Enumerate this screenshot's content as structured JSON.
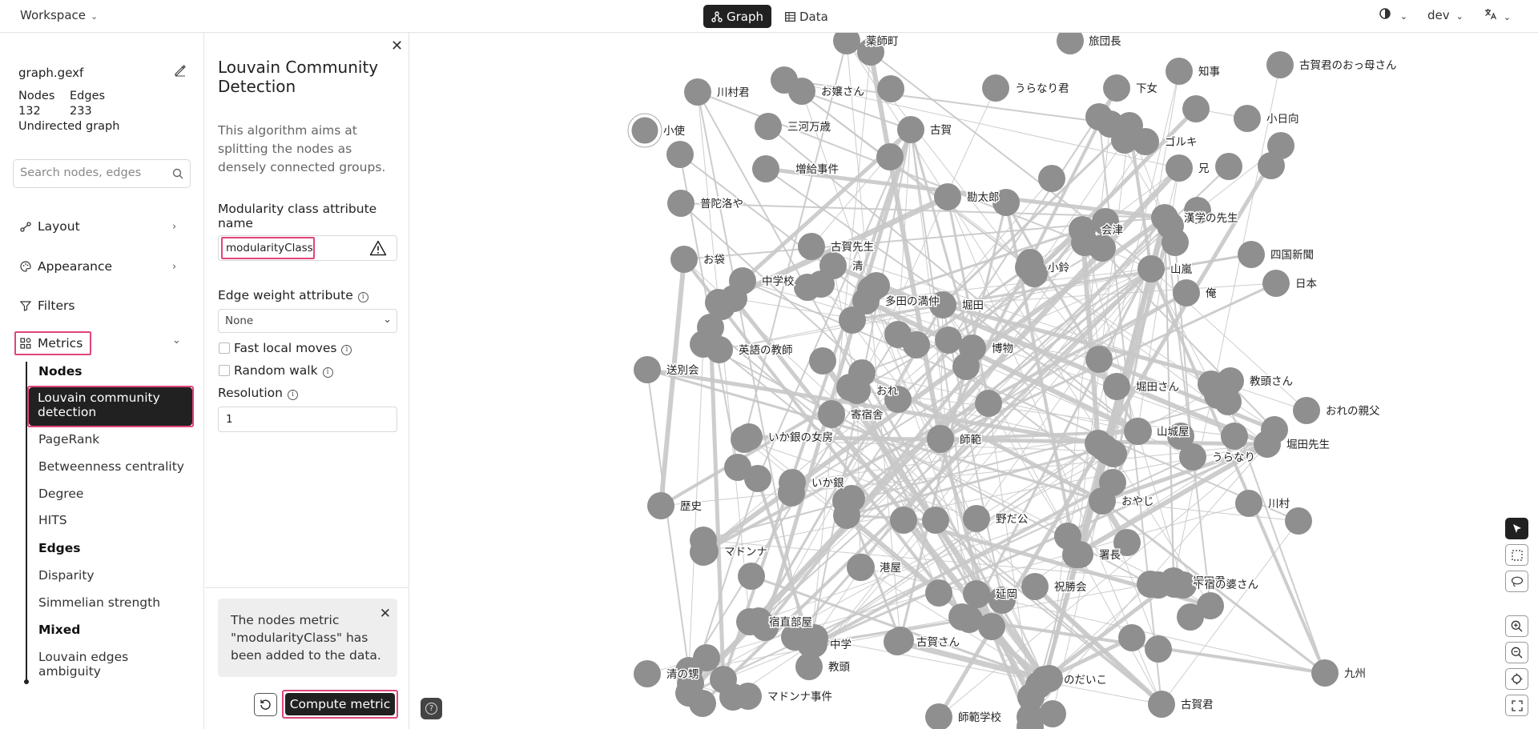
{
  "topbar": {
    "workspace_label": "Workspace",
    "tabs": [
      {
        "label": "Graph",
        "active": true
      },
      {
        "label": "Data",
        "active": false
      }
    ],
    "theme_icon": "contrast-icon",
    "user_label": "dev",
    "lang_icon": "translate-icon"
  },
  "sidebar": {
    "file_name": "graph.gexf",
    "nodes_label": "Nodes",
    "edges_label": "Edges",
    "nodes_count": "132",
    "edges_count": "233",
    "graph_type": "Undirected graph",
    "search_placeholder": "Search nodes, edges",
    "sections": [
      {
        "label": "Layout",
        "icon": "layout-icon"
      },
      {
        "label": "Appearance",
        "icon": "palette-icon"
      },
      {
        "label": "Filters",
        "icon": "filter-icon"
      },
      {
        "label": "Metrics",
        "icon": "metrics-icon"
      }
    ],
    "metrics_items": [
      {
        "label": "Nodes",
        "header": true
      },
      {
        "label": "Louvain community detection",
        "active": true
      },
      {
        "label": "PageRank"
      },
      {
        "label": "Betweenness centrality"
      },
      {
        "label": "Degree"
      },
      {
        "label": "HITS"
      },
      {
        "label": "Edges",
        "header": true
      },
      {
        "label": "Disparity"
      },
      {
        "label": "Simmelian strength"
      },
      {
        "label": "Mixed",
        "header": true
      },
      {
        "label": "Louvain edges ambiguity"
      }
    ]
  },
  "metric_panel": {
    "title": "Louvain Community Detection",
    "description": "This algorithm aims at splitting the nodes as densely connected groups.",
    "attr_label": "Modularity class attribute name",
    "attr_value": "modularityClass",
    "edge_weight_label": "Edge weight attribute",
    "edge_weight_value": "None",
    "fast_local_label": "Fast local moves",
    "random_walk_label": "Random walk",
    "resolution_label": "Resolution",
    "resolution_value": "1",
    "toast_text": "The nodes metric \"modularityClass\" has been added to the data.",
    "compute_label": "Compute metric"
  },
  "graph": {
    "node_color": "#8f8f8f",
    "edge_color": "#c8c8c8",
    "labels": [
      "薬師町",
      "旅団長",
      "知事",
      "古賀君のおっ母さん",
      "川村君",
      "お嬢さん",
      "うらなり君",
      "下女",
      "小使",
      "三河万歳",
      "古賀",
      "小日向",
      "ゴルキ",
      "増給事件",
      "兄",
      "普陀洛や",
      "勘太郎",
      "漢学の先生",
      "会津",
      "古賀先生",
      "清",
      "四国新聞",
      "お袋",
      "小鈴",
      "山嵐",
      "日本",
      "中学校",
      "多田の満仲",
      "堀田",
      "俺",
      "英語の教師",
      "博物",
      "送別会",
      "おれ",
      "堀田さん",
      "教頭さん",
      "寄宿舎",
      "おれの親父",
      "いか銀の女房",
      "師範",
      "山城屋",
      "堀田先生",
      "うらなり",
      "いか銀",
      "おやじ",
      "川村",
      "歴史",
      "野だ公",
      "マドンナ",
      "署長",
      "港屋",
      "祝勝会",
      "堀田君",
      "下宿の婆さん",
      "延岡",
      "宿直部屋",
      "中学",
      "古賀さん",
      "教頭",
      "のだいこ",
      "九州",
      "清の甥",
      "マドンナ事件",
      "古賀君",
      "師範学校"
    ]
  }
}
